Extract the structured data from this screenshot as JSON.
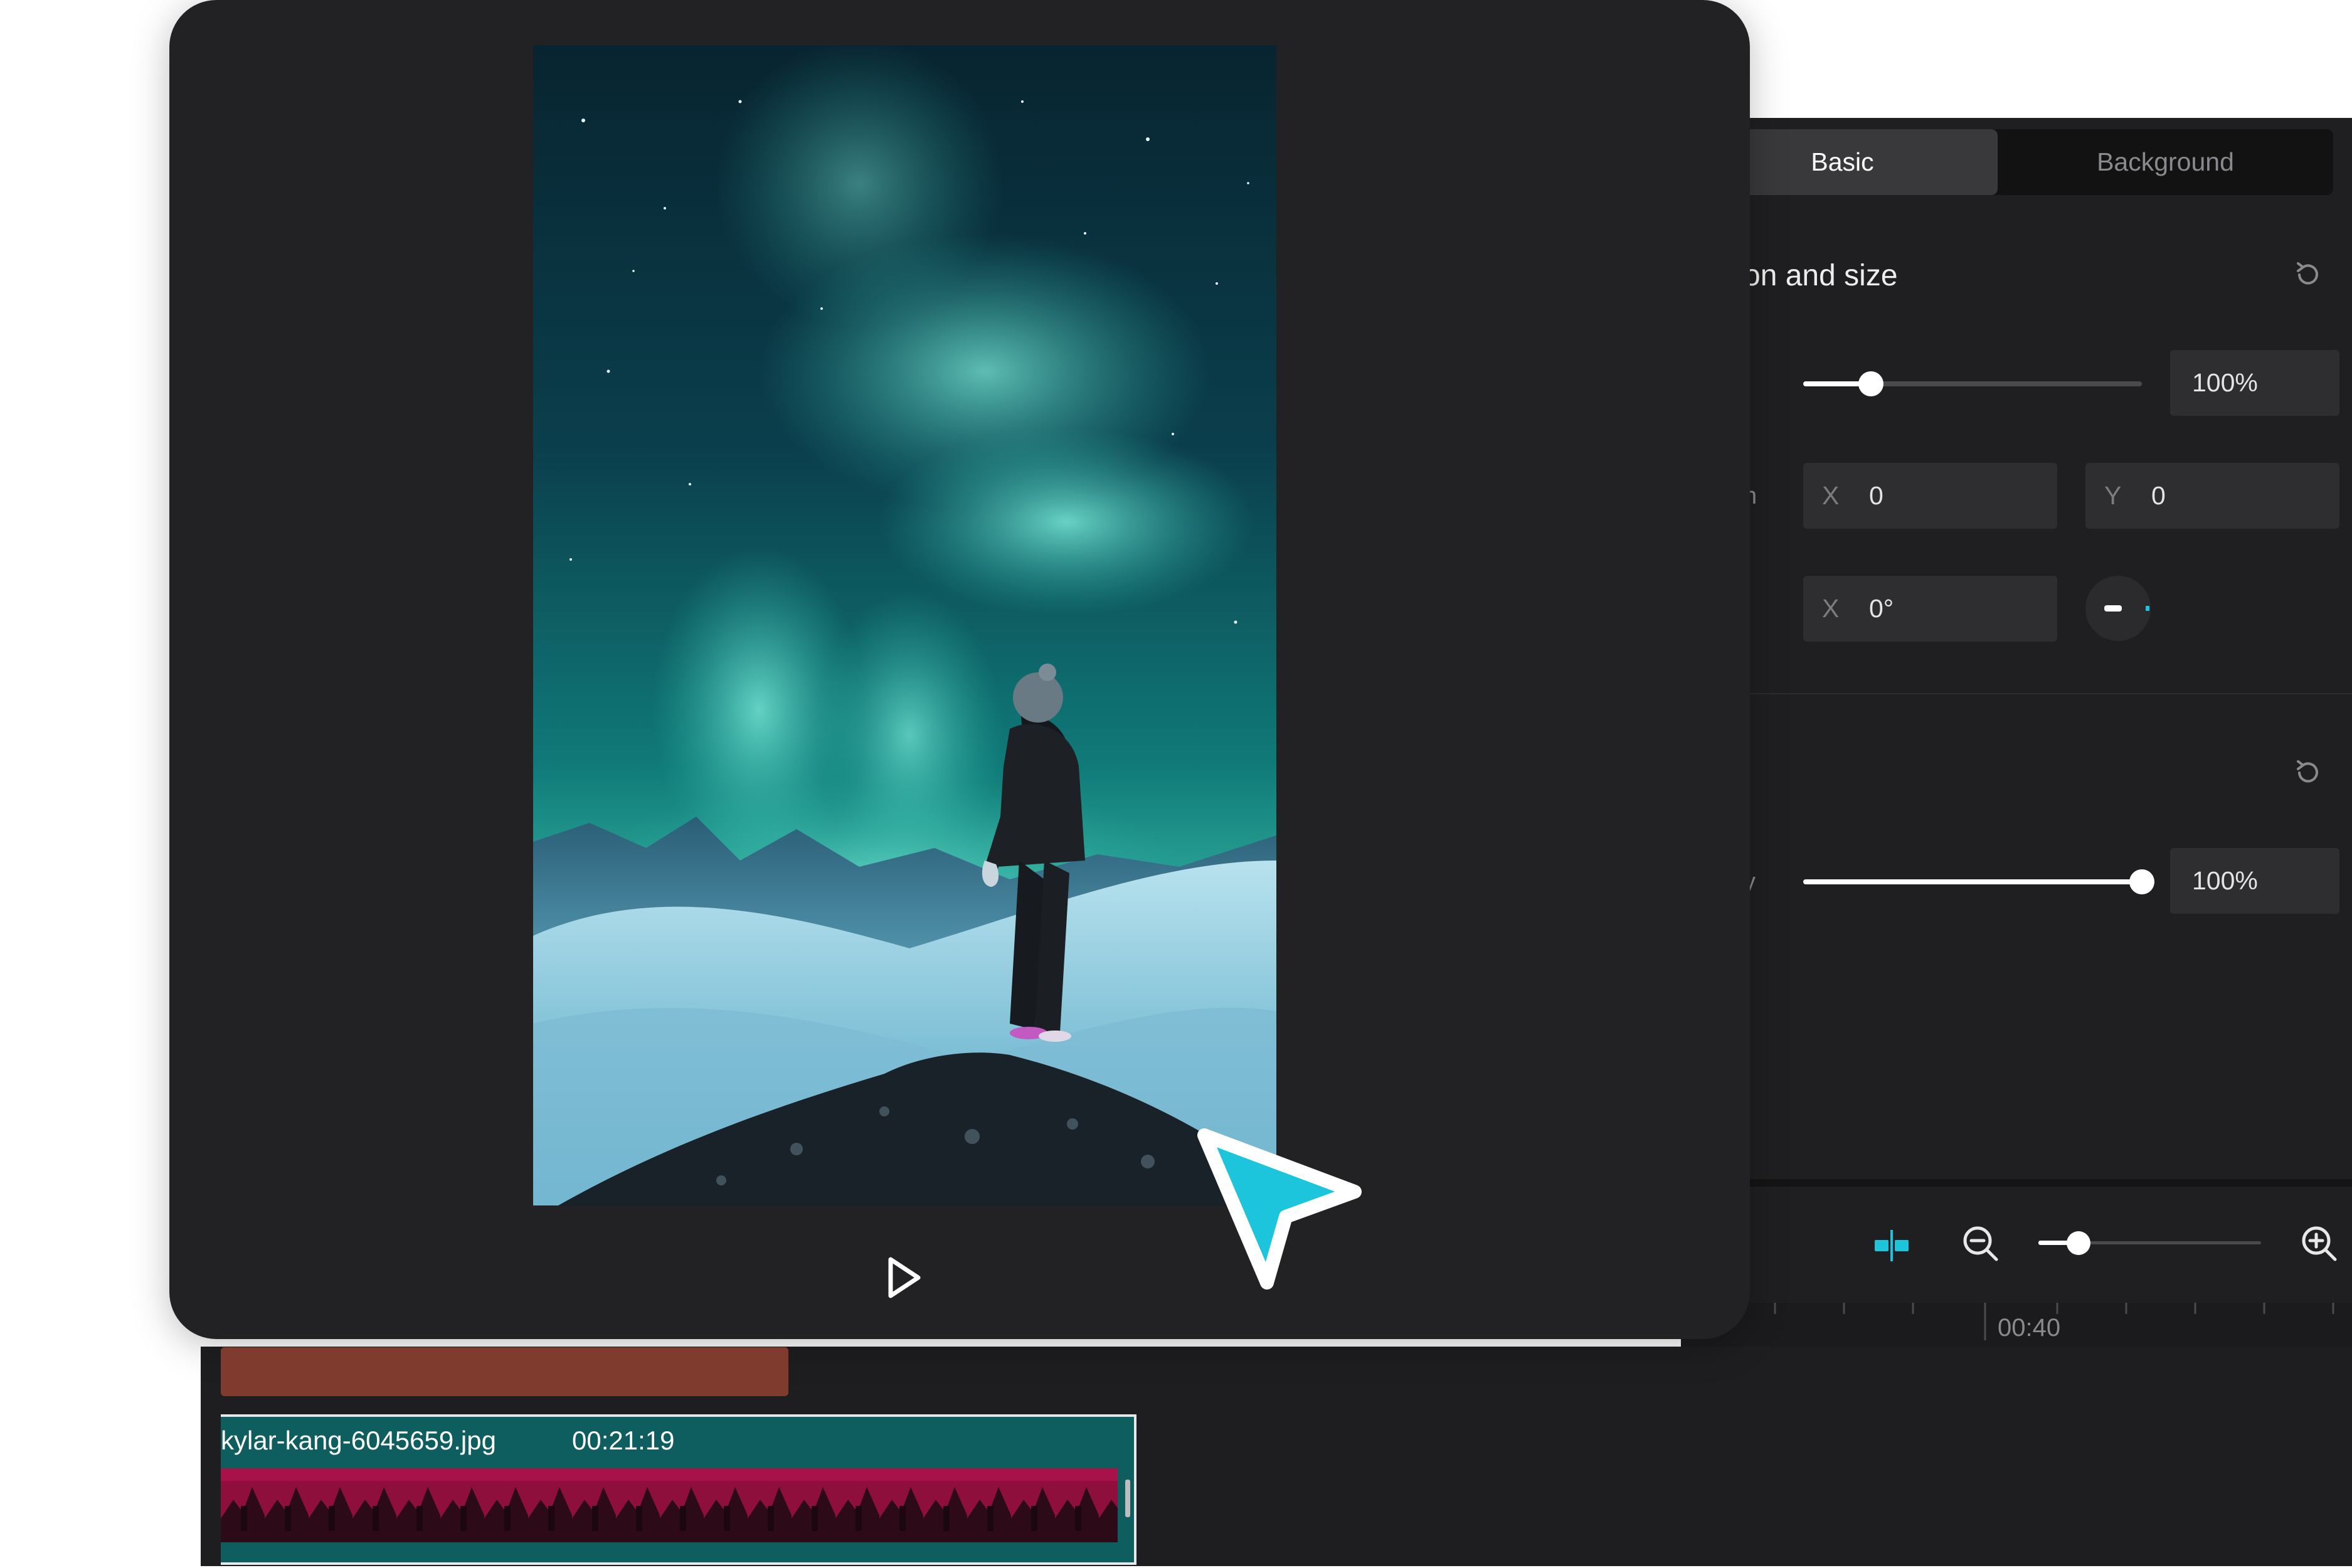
{
  "tabs": [
    {
      "label": "Basic",
      "active": true
    },
    {
      "label": "Background",
      "active": false
    }
  ],
  "transform": {
    "title": "on and size",
    "scale": {
      "value": 0.2,
      "display": "100%"
    },
    "position": {
      "x_label": "X",
      "x_value": "0",
      "y_label": "Y",
      "y_value": "0"
    },
    "rotate": {
      "x_label": "X",
      "value": "0°"
    },
    "row_label_fragments": [
      "n"
    ]
  },
  "opacity": {
    "label_fragment": "y",
    "value": 1.0,
    "display": "100%"
  },
  "timeline": {
    "zoom_level": 0.18,
    "ruler_time": "00:40",
    "clip": {
      "name": "kylar-kang-6045659.jpg",
      "duration": "00:21:19"
    }
  },
  "colors": {
    "accent": "#1cc4dc",
    "panel": "#1f1f21",
    "preview": "#222224",
    "audio_clip": "#7f3c2e",
    "video_clip": "#0f5e5f"
  },
  "icons": [
    "reset-icon",
    "play-icon",
    "snap-icon",
    "zoom-out-icon",
    "zoom-in-icon",
    "cursor-pointer-icon"
  ]
}
